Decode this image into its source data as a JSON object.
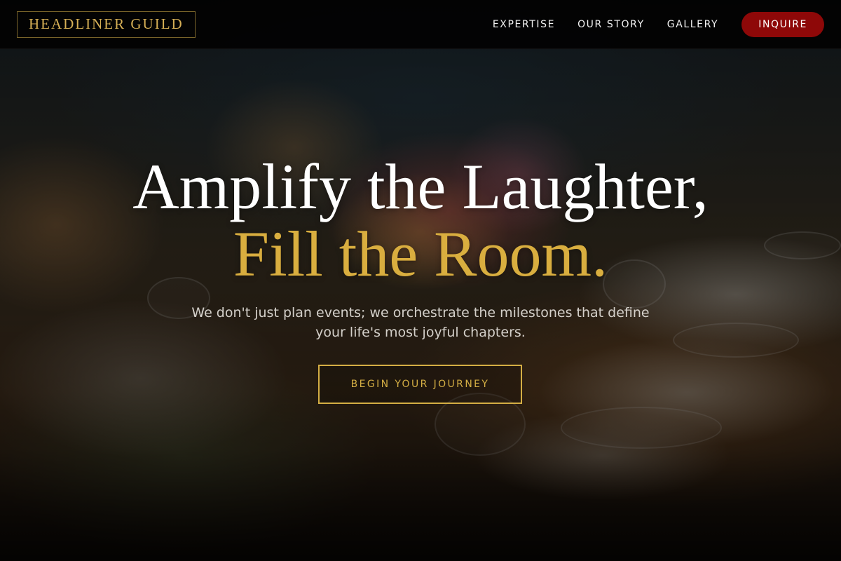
{
  "brand": {
    "name": "HEADLINER GUILD"
  },
  "nav": {
    "links": [
      {
        "label": "EXPERTISE"
      },
      {
        "label": "OUR STORY"
      },
      {
        "label": "GALLERY"
      }
    ],
    "cta_label": "INQUIRE"
  },
  "hero": {
    "headline_line1": "Amplify the Laughter,",
    "headline_line2": "Fill the Room.",
    "subheadline": "We don't just plan events; we orchestrate the milestones that define your life's most joyful chapters.",
    "cta_label": "BEGIN YOUR JOURNEY"
  },
  "colors": {
    "accent_gold": "#d9ae3f",
    "inquire_red": "#8e0808",
    "nav_background": "#020202"
  }
}
